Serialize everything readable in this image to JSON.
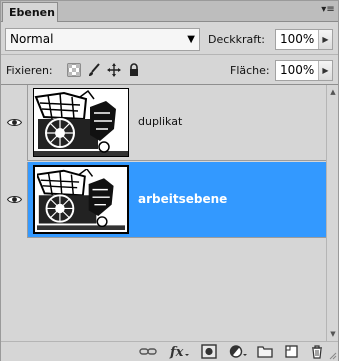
{
  "panel": {
    "tab_label": "Ebenen",
    "menu_icon": "panel-menu-icon"
  },
  "options": {
    "blend_mode": "Normal",
    "opacity_label": "Deckkraft:",
    "opacity_value": "100%",
    "lock_label": "Fixieren:",
    "fill_label": "Fläche:",
    "fill_value": "100%"
  },
  "locks": [
    "lock-transparency-icon",
    "lock-brush-icon",
    "lock-move-icon",
    "lock-all-icon"
  ],
  "layers": [
    {
      "name": "duplikat",
      "visible": true,
      "selected": false
    },
    {
      "name": "arbeitsebene",
      "visible": true,
      "selected": true
    }
  ],
  "toolbar": [
    "link-icon",
    "fx-icon",
    "mask-icon",
    "adjustment-icon",
    "group-folder-icon",
    "new-layer-icon",
    "trash-icon"
  ],
  "colors": {
    "selection": "#3399ff",
    "panel_bg": "#d6d6d6"
  }
}
